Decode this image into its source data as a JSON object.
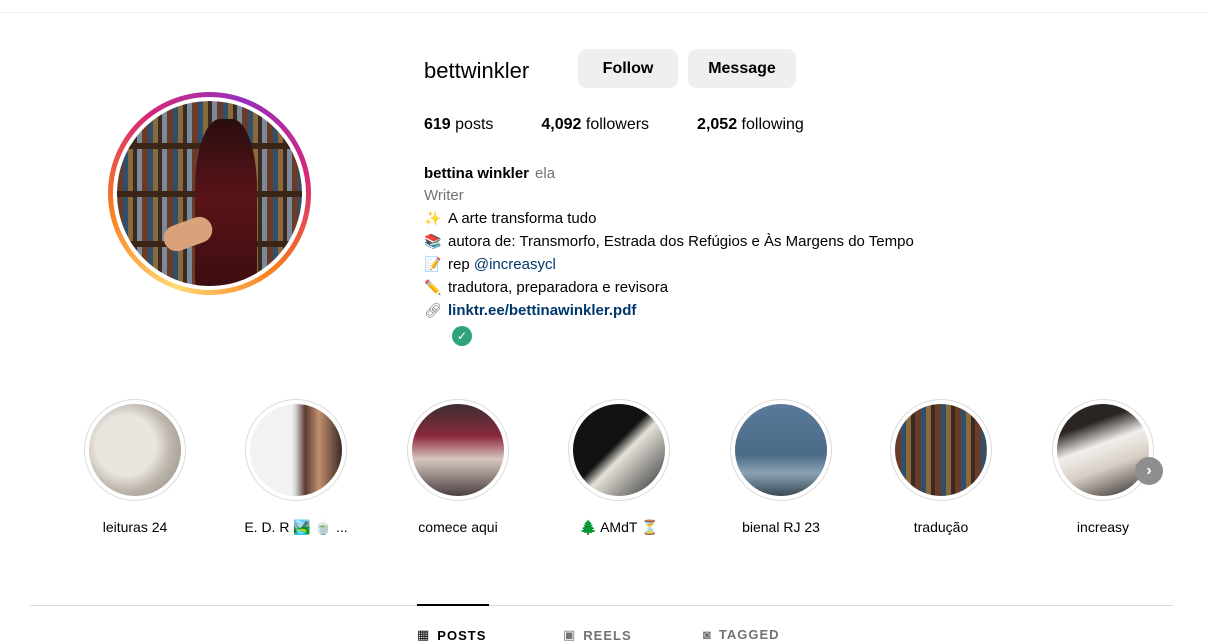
{
  "profile": {
    "username": "bettwinkler",
    "follow_label": "Follow",
    "message_label": "Message",
    "stats": {
      "posts_count": "619",
      "posts_label": "posts",
      "followers_count": "4,092",
      "followers_label": "followers",
      "following_count": "2,052",
      "following_label": "following"
    },
    "bio": {
      "name": "bettina winkler",
      "pronouns": "ela",
      "category": "Writer",
      "lines": [
        {
          "emoji": "✨",
          "text": "A arte transforma tudo"
        },
        {
          "emoji": "📚",
          "text": "autora de: Transmorfo, Estrada dos Refúgios e Às Margens do Tempo"
        },
        {
          "emoji": "📝",
          "text_prefix": "rep ",
          "mention": "@increasycl"
        },
        {
          "emoji": "✏️",
          "text": "tradutora, preparadora e revisora"
        }
      ],
      "link": "linktr.ee/bettinawinkler.pdf"
    }
  },
  "highlights": [
    {
      "label": "leituras 24"
    },
    {
      "label": "E. D. R 🏞️ 🍵 ..."
    },
    {
      "label": "comece aqui"
    },
    {
      "label": "🌲 AMdT ⏳"
    },
    {
      "label": "bienal RJ 23"
    },
    {
      "label": "tradução"
    },
    {
      "label": "increasy"
    }
  ],
  "tabs": [
    {
      "label": "POSTS",
      "icon": "grid-icon",
      "active": true
    },
    {
      "label": "REELS",
      "icon": "reels-icon",
      "active": false
    },
    {
      "label": "TAGGED",
      "icon": "tagged-icon",
      "active": false
    }
  ]
}
